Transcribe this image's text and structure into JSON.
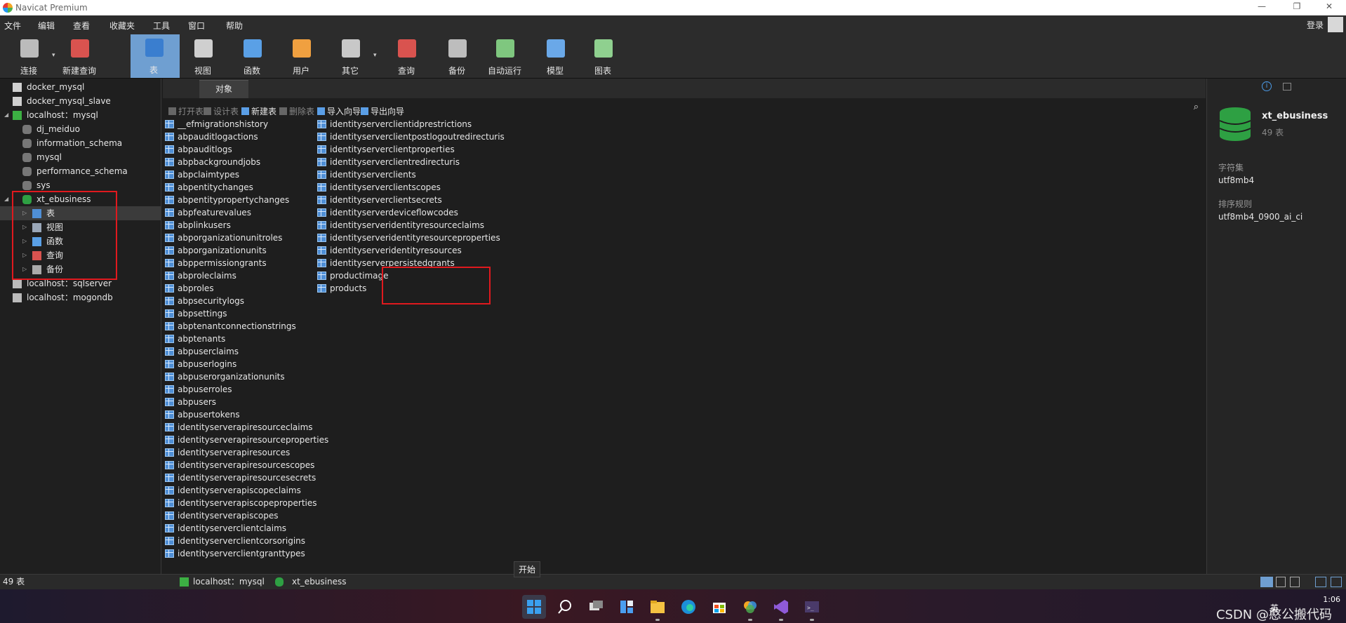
{
  "window": {
    "title": "Navicat Premium",
    "min": "—",
    "restore": "❐",
    "close": "✕"
  },
  "menu": [
    "文件",
    "编辑",
    "查看",
    "收藏夹",
    "工具",
    "窗口",
    "帮助"
  ],
  "login": "登录",
  "toolbar": [
    {
      "label": "连接",
      "icon": "plug-icon",
      "color": "#bbbbbb",
      "active": false,
      "dropdown": true
    },
    {
      "label": "新建查询",
      "icon": "new-query-icon",
      "color": "#d9534f",
      "active": false
    },
    {
      "label": "表",
      "icon": "table-icon",
      "color": "#3a7ecf",
      "active": true
    },
    {
      "label": "视图",
      "icon": "view-icon",
      "color": "#cfcfcf",
      "active": false
    },
    {
      "label": "函数",
      "icon": "function-icon",
      "color": "#5aa0e6",
      "active": false
    },
    {
      "label": "用户",
      "icon": "user-icon",
      "color": "#f0a040",
      "active": false
    },
    {
      "label": "其它",
      "icon": "tools-icon",
      "color": "#c8c8c8",
      "active": false,
      "dropdown": true
    },
    {
      "label": "查询",
      "icon": "query-icon",
      "color": "#d9534f",
      "active": false
    },
    {
      "label": "备份",
      "icon": "backup-icon",
      "color": "#bdbdbd",
      "active": false
    },
    {
      "label": "自动运行",
      "icon": "auto-run-icon",
      "color": "#7fc77f",
      "active": false
    },
    {
      "label": "模型",
      "icon": "model-icon",
      "color": "#6aa8e8",
      "active": false
    },
    {
      "label": "图表",
      "icon": "chart-icon",
      "color": "#8fd08f",
      "active": false
    }
  ],
  "tree": [
    {
      "label": "docker_mysql",
      "level": 0,
      "icon": "connection-icon",
      "color": "#d0d0d0",
      "arrow": ""
    },
    {
      "label": "docker_mysql_slave",
      "level": 0,
      "icon": "connection-icon",
      "color": "#d0d0d0",
      "arrow": ""
    },
    {
      "label": "localhost：mysql",
      "level": 0,
      "icon": "connection-open-icon",
      "color": "#3cb043",
      "arrow": "◢"
    },
    {
      "label": "dj_meiduo",
      "level": 1,
      "icon": "database-icon",
      "color": "#777777",
      "arrow": ""
    },
    {
      "label": "information_schema",
      "level": 1,
      "icon": "database-icon",
      "color": "#777777",
      "arrow": ""
    },
    {
      "label": "mysql",
      "level": 1,
      "icon": "database-icon",
      "color": "#777777",
      "arrow": ""
    },
    {
      "label": "performance_schema",
      "level": 1,
      "icon": "database-icon",
      "color": "#777777",
      "arrow": ""
    },
    {
      "label": "sys",
      "level": 1,
      "icon": "database-icon",
      "color": "#777777",
      "arrow": ""
    },
    {
      "label": "xt_ebusiness",
      "level": 1,
      "icon": "database-open-icon",
      "color": "#2ea043",
      "arrow": "◢"
    },
    {
      "label": "表",
      "level": 2,
      "icon": "table-icon",
      "color": "#4f8fd6",
      "arrow": "▷",
      "selected": true
    },
    {
      "label": "视图",
      "level": 2,
      "icon": "view-icon",
      "color": "#9aa7b8",
      "arrow": "▷"
    },
    {
      "label": "函数",
      "level": 2,
      "icon": "function-icon",
      "color": "#5aa0e6",
      "arrow": "▷"
    },
    {
      "label": "查询",
      "level": 2,
      "icon": "query-icon",
      "color": "#d9534f",
      "arrow": "▷"
    },
    {
      "label": "备份",
      "level": 2,
      "icon": "backup-icon",
      "color": "#aaaaaa",
      "arrow": "▷"
    },
    {
      "label": "localhost：sqlserver",
      "level": 0,
      "icon": "sqlserver-icon",
      "color": "#bbbbbb",
      "arrow": ""
    },
    {
      "label": "localhost：mogondb",
      "level": 0,
      "icon": "mongodb-icon",
      "color": "#bbbbbb",
      "arrow": ""
    }
  ],
  "tabs": {
    "objects": "对象"
  },
  "objbar": [
    {
      "label": "打开表",
      "icon": "open-table-icon",
      "enabled": false
    },
    {
      "label": "设计表",
      "icon": "design-table-icon",
      "enabled": false
    },
    {
      "label": "新建表",
      "icon": "new-table-icon",
      "enabled": true
    },
    {
      "label": "删除表",
      "icon": "delete-table-icon",
      "enabled": false
    },
    {
      "label": "导入向导",
      "icon": "import-wizard-icon",
      "enabled": true
    },
    {
      "label": "导出向导",
      "icon": "export-wizard-icon",
      "enabled": true
    }
  ],
  "tables_col1": [
    "__efmigrationshistory",
    "abpauditlogactions",
    "abpauditlogs",
    "abpbackgroundjobs",
    "abpclaimtypes",
    "abpentitychanges",
    "abpentitypropertychanges",
    "abpfeaturevalues",
    "abplinkusers",
    "abporganizationunitroles",
    "abporganizationunits",
    "abppermissiongrants",
    "abproleclaims",
    "abproles",
    "abpsecuritylogs",
    "abpsettings",
    "abptenantconnectionstrings",
    "abptenants",
    "abpuserclaims",
    "abpuserlogins",
    "abpuserorganizationunits",
    "abpuserroles",
    "abpusers",
    "abpusertokens",
    "identityserverapiresourceclaims",
    "identityserverapiresourceproperties",
    "identityserverapiresources",
    "identityserverapiresourcescopes",
    "identityserverapiresourcesecrets",
    "identityserverapiscopeclaims",
    "identityserverapiscopeproperties",
    "identityserverapiscopes",
    "identityserverclientclaims",
    "identityserverclientcorsorigins",
    "identityserverclientgranttypes"
  ],
  "tables_col2": [
    "identityserverclientidprestrictions",
    "identityserverclientpostlogoutredirecturis",
    "identityserverclientproperties",
    "identityserverclientredirecturis",
    "identityserverclients",
    "identityserverclientscopes",
    "identityserverclientsecrets",
    "identityserverdeviceflowcodes",
    "identityserveridentityresourceclaims",
    "identityserveridentityresourceproperties",
    "identityserveridentityresources",
    "identityserverpersistedgrants",
    "productimage",
    "products"
  ],
  "info": {
    "name": "xt_ebusiness",
    "count": "49 表",
    "charset_label": "字符集",
    "charset": "utf8mb4",
    "collation_label": "排序规则",
    "collation": "utf8mb4_0900_ai_ci"
  },
  "status": {
    "count": "49 表",
    "connection": "localhost：mysql",
    "database": "xt_ebusiness"
  },
  "taskbar": {
    "tooltip": "开始",
    "clock_time": "1:06",
    "ime": "英",
    "watermark": "CSDN @憨公搬代码"
  },
  "colors": {
    "highlight": "#e0191e",
    "accent": "#6f9fd1"
  }
}
